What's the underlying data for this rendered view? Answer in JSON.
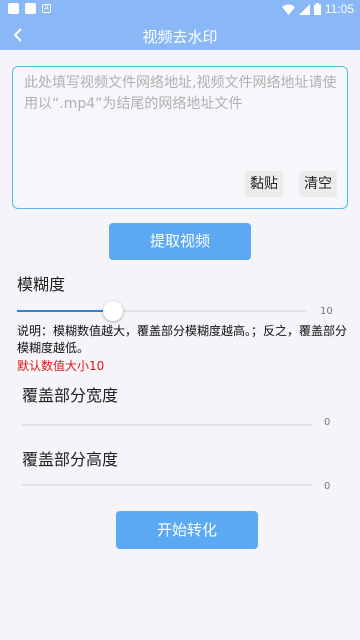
{
  "status_bar": {
    "time": "11:05"
  },
  "title_bar": {
    "title": "视频去水印"
  },
  "url_box": {
    "placeholder": "此处填写视频文件网络地址,视频文件网络地址请使用以“.mp4”为结尾的网络地址文件",
    "value": "",
    "paste_label": "黏贴",
    "clear_label": "清空"
  },
  "extract_button": "提取视频",
  "blur": {
    "label": "模糊度",
    "value": 10,
    "value_text": "10",
    "max": 100,
    "description": "说明：模糊数值越大，覆盖部分模糊度越高。；反之，覆盖部分模糊度越低。",
    "default_note": "默认数值大小10"
  },
  "cover_width": {
    "label": "覆盖部分宽度",
    "value": 0,
    "value_text": "0"
  },
  "cover_height": {
    "label": "覆盖部分高度",
    "value": 0,
    "value_text": "0"
  },
  "start_button": "开始转化",
  "colors": {
    "accent": "#8ab8f6",
    "button": "#5ba8f3",
    "slider": "#2b86d6",
    "warning": "#e01818"
  }
}
